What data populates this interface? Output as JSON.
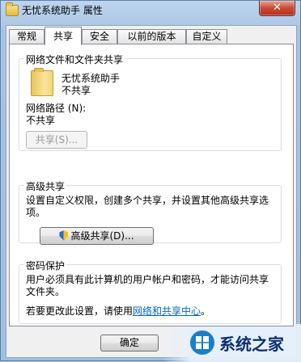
{
  "window": {
    "title": "无忧系统助手 属性",
    "close_symbol": "✕"
  },
  "tabs": [
    {
      "label": "常规",
      "active": false
    },
    {
      "label": "共享",
      "active": true
    },
    {
      "label": "安全",
      "active": false
    },
    {
      "label": "以前的版本",
      "active": false
    },
    {
      "label": "自定义",
      "active": false
    }
  ],
  "network_sharing": {
    "group_title": "网络文件和文件夹共享",
    "folder_name": "无忧系统助手",
    "folder_status": "不共享",
    "path_label": "网络路径 (N):",
    "path_value": "不共享",
    "share_button": "共享(S)..."
  },
  "advanced_sharing": {
    "group_title": "高级共享",
    "description": "设置自定义权限，创建多个共享，并设置其他高级共享选项。",
    "button": "高级共享(D)..."
  },
  "password": {
    "group_title": "密码保护",
    "description": "用户必须具有此计算机的用户帐户和密码，才能访问共享文件夹。",
    "change_prefix": "若要更改此设置，请使用",
    "link": "网络和共享中心",
    "change_suffix": "。"
  },
  "footer": {
    "ok_button": "确定"
  },
  "watermark": {
    "text": "系统之家"
  }
}
